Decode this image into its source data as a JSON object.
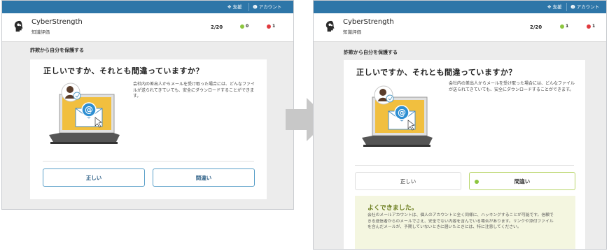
{
  "topbar": {
    "help_label": "支援",
    "account_label": "アカウント"
  },
  "app": {
    "title": "CyberStrength",
    "subtitle": "知識評価"
  },
  "progress": {
    "counter": "2/20",
    "correct_count": "0",
    "wrong_count": "1"
  },
  "progress_after": {
    "counter": "2/20",
    "correct_count": "1",
    "wrong_count": "1"
  },
  "section": {
    "title": "詐欺から自分を保護する"
  },
  "question": {
    "title": "正しいですか、それとも間違っていますか？",
    "description": "会社内の差出人からメールを受け取った場合には、どんなファイルが送られてきていても、安全にダウンロードすることができます。"
  },
  "answers": {
    "true_label": "正しい",
    "false_label": "間違い"
  },
  "feedback": {
    "title": "よくできました。",
    "body": "会社のメールアカウントは、個人のアカウントと全く同様に、ハッキングすることが可能です。信頼できる送信者からのメールでさえ、安全でない内容を含んでいる場合があります。リンクや添付ファイルを含んだメールが、予期していないときに届いたときには、特に注意してください。"
  },
  "colors": {
    "topbar": "#2e76a8",
    "correct": "#8dc63f",
    "wrong": "#e0393e",
    "accent": "#5aa0c9"
  }
}
